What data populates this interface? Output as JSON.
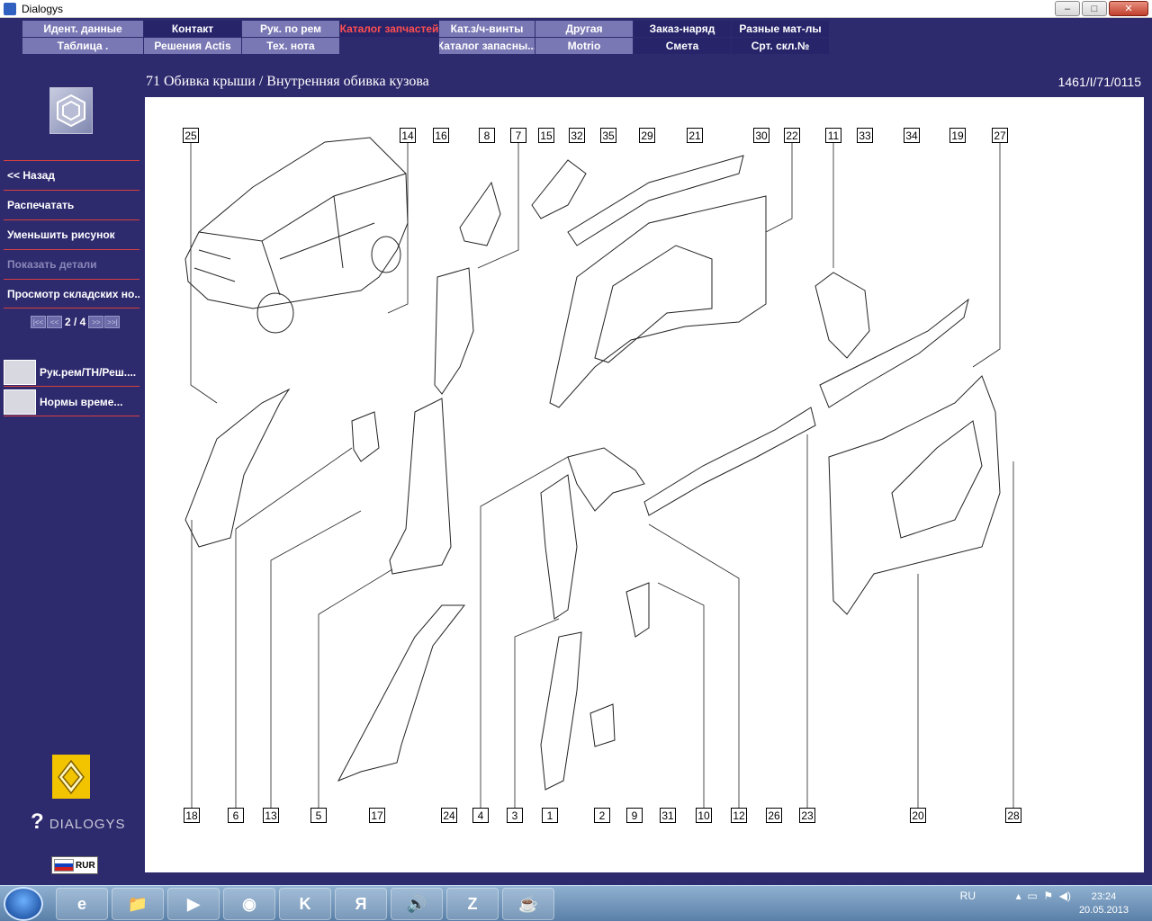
{
  "window": {
    "title": "Dialogys",
    "buttons": [
      "–",
      "□",
      "✕"
    ]
  },
  "tabs": {
    "row1": [
      {
        "label": "Идент. данные",
        "style": "light"
      },
      {
        "label": "Контакт",
        "style": "dark"
      },
      {
        "label": "Рук. по рем",
        "style": "light"
      },
      {
        "label": "Каталог запчастей",
        "style": "active"
      },
      {
        "label": "Кат.з/ч-винты",
        "style": "light"
      },
      {
        "label": "Другая",
        "style": "light"
      },
      {
        "label": "Заказ-наряд",
        "style": "dark"
      },
      {
        "label": "Разные мат-лы",
        "style": "dark"
      }
    ],
    "row2": [
      {
        "label": "Таблица .",
        "style": "light"
      },
      {
        "label": "Решения Actis",
        "style": "light"
      },
      {
        "label": "Тех. нота",
        "style": "light"
      },
      {
        "label": "",
        "style": "empty"
      },
      {
        "label": "Каталог запасны...",
        "style": "light"
      },
      {
        "label": "Motrio",
        "style": "light"
      },
      {
        "label": "Смета",
        "style": "dark"
      },
      {
        "label": "Срт. скл.№",
        "style": "dark"
      }
    ]
  },
  "header": {
    "title": "71 Обивка крыши / Внутренняя обивка кузова",
    "ref": "1461/I/71/0115"
  },
  "sidebar": {
    "items": [
      {
        "label": "<< Назад",
        "enabled": true
      },
      {
        "label": "Распечатать",
        "enabled": true
      },
      {
        "label": "Уменьшить рисунок",
        "enabled": true
      },
      {
        "label": "Показать детали",
        "enabled": false
      },
      {
        "label": "Просмотр складских но...",
        "enabled": true
      }
    ],
    "pager": {
      "first": "|<<",
      "prev": "<<",
      "text": "2 / 4",
      "next": ">>",
      "last": ">>|"
    },
    "links": [
      {
        "label": "Рук.рем/ТН/Реш...."
      },
      {
        "label": "Нормы време..."
      }
    ],
    "brand": "DIALOGYS",
    "currency": "RUR"
  },
  "diagram": {
    "top_callouts": [
      "25",
      "14",
      "16",
      "8",
      "7",
      "15",
      "32",
      "35",
      "29",
      "21",
      "30",
      "22",
      "11",
      "33",
      "34",
      "19",
      "27"
    ],
    "bottom_callouts": [
      "18",
      "6",
      "13",
      "5",
      "17",
      "24",
      "4",
      "3",
      "1",
      "2",
      "9",
      "31",
      "10",
      "12",
      "26",
      "23",
      "20",
      "28"
    ]
  },
  "taskbar": {
    "apps": [
      "e",
      "📁",
      "▶",
      "◉",
      "K",
      "Я",
      "🔊",
      "Z",
      "☕"
    ],
    "lang": "RU",
    "time": "23:24",
    "date": "20.05.2013"
  }
}
